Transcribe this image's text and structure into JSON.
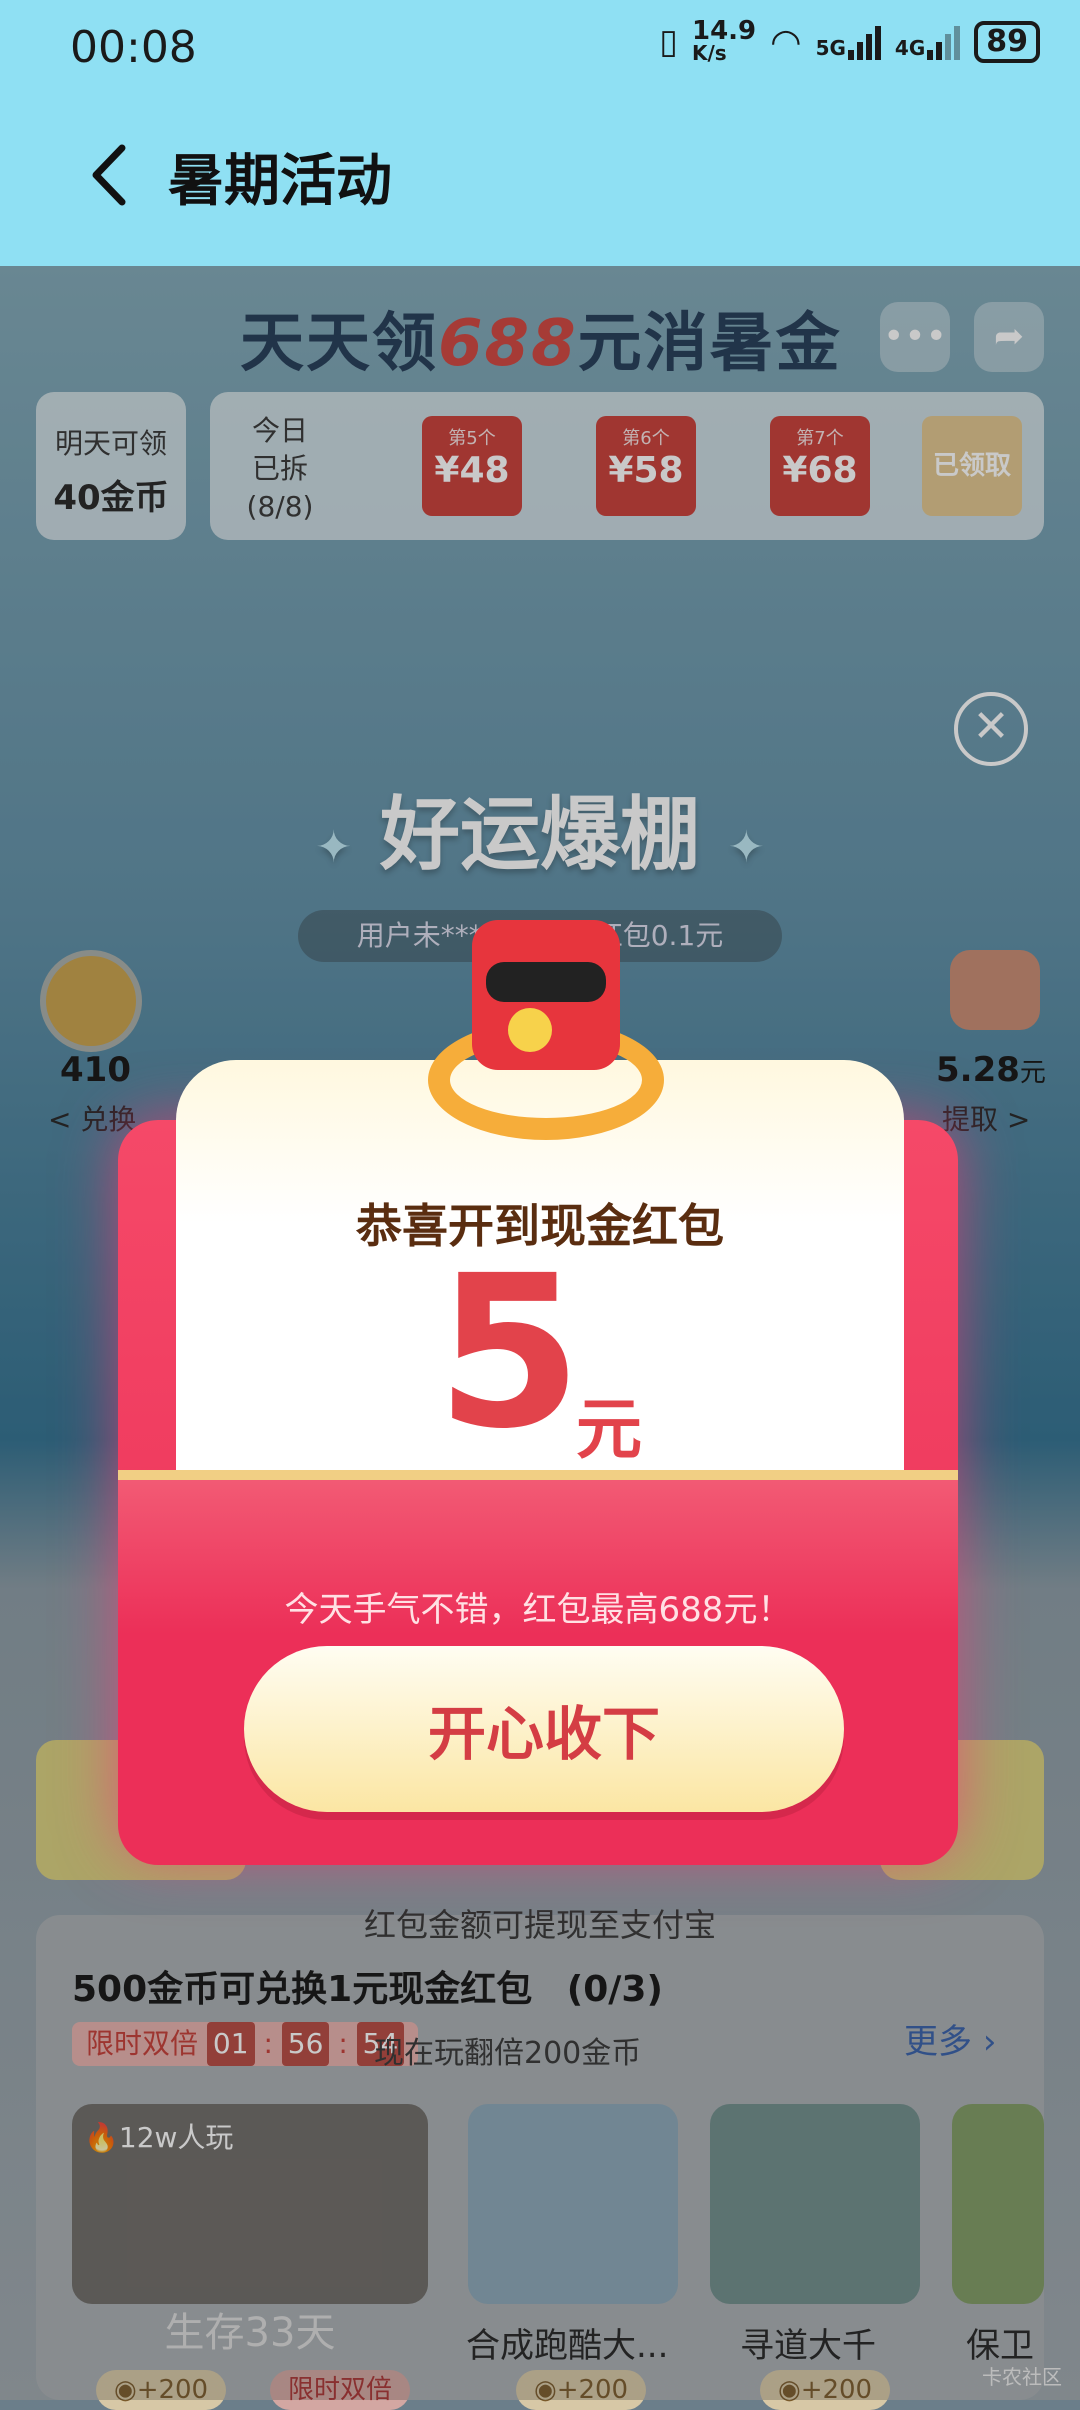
{
  "status": {
    "time": "00:08",
    "net_speed": "14.9",
    "net_unit": "K/s",
    "sim1": "5G",
    "sim2": "4G",
    "battery": "89"
  },
  "header": {
    "title": "暑期活动"
  },
  "banner": {
    "title_a": "天天领",
    "title_num": "688",
    "title_b": "元消暑金"
  },
  "tomorrow": {
    "label": "明天可领",
    "value": "40金币"
  },
  "redpackets": {
    "opened_label": "今日已拆(8/8)",
    "items": [
      {
        "tag": "第5个",
        "value": "¥48"
      },
      {
        "tag": "第6个",
        "value": "¥58"
      },
      {
        "tag": "第7个",
        "value": "¥68"
      }
    ],
    "claimed": "已领取"
  },
  "lucky": {
    "title": "好运爆棚",
    "ticker": "用户未*******获得红包0.1元"
  },
  "coins": {
    "count": "410",
    "exchange": "< 兑换"
  },
  "cash": {
    "value": "5.28",
    "unit": "元",
    "withdraw": "提取 >"
  },
  "dialog": {
    "congrats": "恭喜开到现金红包",
    "amount": "5",
    "unit": "元",
    "tip": "今天手气不错，红包最高688元！",
    "accept": "开心收下"
  },
  "bottom": {
    "withdraw_note": "红包金额可提现至支付宝",
    "exchange_title": "500金币可兑换1元现金红包",
    "exchange_progress": "(0/3)",
    "limited_label": "限时双倍",
    "timer": {
      "h": "01",
      "m": "56",
      "s": "54"
    },
    "play_text": "现在玩翻倍200金币",
    "more": "更多",
    "games": [
      {
        "name": "生存33天",
        "badge": "12w人玩",
        "reward": "+200",
        "bonus": "限时双倍"
      },
      {
        "name": "合成跑酷大...",
        "reward": "+200"
      },
      {
        "name": "寻道大千",
        "reward": "+200"
      },
      {
        "name": "保卫"
      }
    ]
  },
  "watermark": "卡农社区"
}
